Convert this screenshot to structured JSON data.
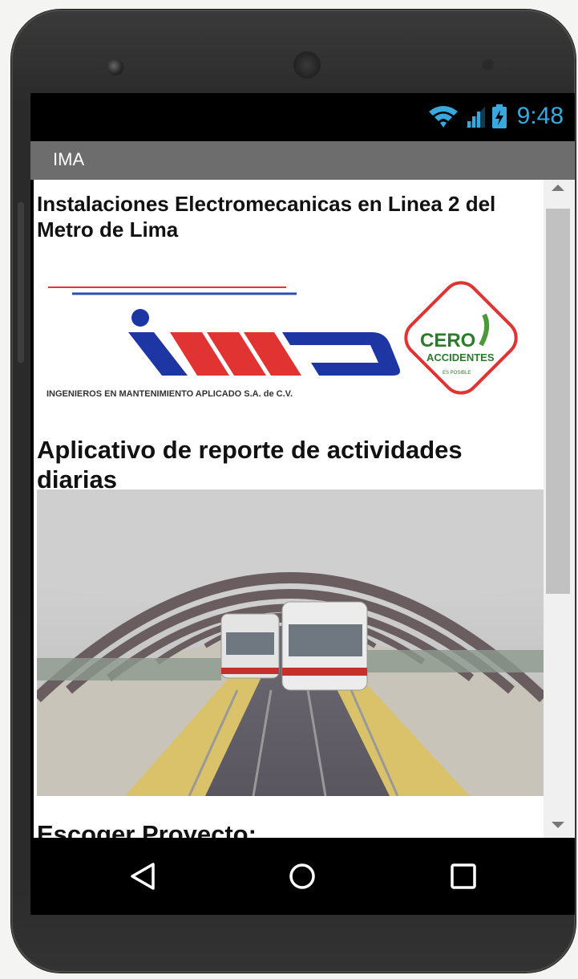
{
  "status_bar": {
    "time": "9:48",
    "icons": [
      "wifi-icon",
      "signal-icon",
      "battery-charging-icon"
    ],
    "accent_color": "#38a8dd"
  },
  "app_bar": {
    "title": "IMA",
    "color": "#6d6d6d"
  },
  "content": {
    "heading1": "Instalaciones Electromecanicas en Linea 2 del Metro de Lima",
    "logo": {
      "company_text": "INGENIEROS EN MANTENIMIENTO APLICADO S.A. de C.V.",
      "badge_line1": "CERO",
      "badge_line2": "ACCIDENTES",
      "badge_line3": "ES POSIBLE"
    },
    "heading2": "Aplicativo de reporte de actividades diarias",
    "photo_icon": "metro-station-image",
    "heading3": "Escoger Proyecto:"
  },
  "nav_bar": {
    "buttons": [
      "back-icon",
      "home-icon",
      "recents-icon"
    ]
  }
}
